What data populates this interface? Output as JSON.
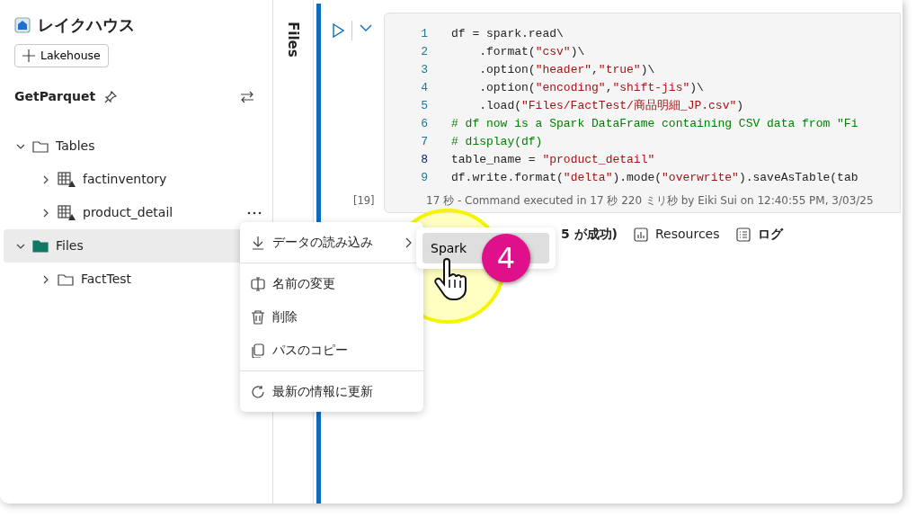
{
  "app": {
    "title": "レイクハウス",
    "add_button": "Lakehouse"
  },
  "lakehouse": {
    "name": "GetParquet"
  },
  "tree": [
    {
      "label": "Tables",
      "kind": "folder",
      "expanded": true,
      "selected": false,
      "children": [
        {
          "label": "factinventory",
          "kind": "table",
          "expanded": false,
          "selected": false
        },
        {
          "label": "product_detail",
          "kind": "table",
          "expanded": false,
          "selected": false,
          "more": true
        }
      ]
    },
    {
      "label": "Files",
      "kind": "files",
      "expanded": true,
      "selected": true,
      "children": [
        {
          "label": "FactTest",
          "kind": "folder",
          "expanded": false,
          "selected": false
        }
      ]
    }
  ],
  "side_tab": "Files",
  "cell": {
    "lines": [
      {
        "number": "1",
        "current": false,
        "tokens": [
          {
            "kind": "plain",
            "text": "df = spark.read\\"
          }
        ]
      },
      {
        "number": "2",
        "current": false,
        "tokens": [
          {
            "kind": "plain",
            "text": "    .format("
          },
          {
            "kind": "string",
            "text": "\"csv\""
          },
          {
            "kind": "plain",
            "text": ")\\"
          }
        ]
      },
      {
        "number": "3",
        "current": false,
        "tokens": [
          {
            "kind": "plain",
            "text": "    .option("
          },
          {
            "kind": "string",
            "text": "\"header\""
          },
          {
            "kind": "plain",
            "text": ","
          },
          {
            "kind": "string",
            "text": "\"true\""
          },
          {
            "kind": "plain",
            "text": ")\\"
          }
        ]
      },
      {
        "number": "4",
        "current": false,
        "tokens": [
          {
            "kind": "plain",
            "text": "    .option("
          },
          {
            "kind": "string",
            "text": "\"encoding\""
          },
          {
            "kind": "plain",
            "text": ","
          },
          {
            "kind": "string",
            "text": "\"shift-jis\""
          },
          {
            "kind": "plain",
            "text": ")\\"
          }
        ]
      },
      {
        "number": "5",
        "current": false,
        "tokens": [
          {
            "kind": "plain",
            "text": "    .load("
          },
          {
            "kind": "string",
            "text": "\"Files/FactTest/商品明細_JP.csv\""
          },
          {
            "kind": "plain",
            "text": ")"
          }
        ]
      },
      {
        "number": "6",
        "current": false,
        "tokens": [
          {
            "kind": "comment",
            "text": "# df now is a Spark DataFrame containing CSV data from \"Fi"
          }
        ]
      },
      {
        "number": "7",
        "current": false,
        "tokens": [
          {
            "kind": "comment",
            "text": "# display(df)"
          }
        ]
      },
      {
        "number": "8",
        "current": true,
        "tokens": [
          {
            "kind": "plain",
            "text": "table_name = "
          },
          {
            "kind": "string",
            "text": "\"product_detail\""
          }
        ]
      },
      {
        "number": "9",
        "current": false,
        "tokens": [
          {
            "kind": "plain",
            "text": "df.write.format("
          },
          {
            "kind": "string",
            "text": "\"delta\""
          },
          {
            "kind": "plain",
            "text": ").mode("
          },
          {
            "kind": "string",
            "text": "\"overwrite\""
          },
          {
            "kind": "plain",
            "text": ").saveAsTable(tab"
          }
        ]
      }
    ],
    "exec_count": "[19]",
    "status": "17 秒 - Command executed in 17 秒 220 ミリ秒 by Eiki Sui on 12:40:55 PM, 3/03/25"
  },
  "output_bar": [
    {
      "label": "5 が成功)",
      "kind": "jobs"
    },
    {
      "label": "Resources",
      "kind": "resources"
    },
    {
      "label": "ログ",
      "kind": "log"
    }
  ],
  "context_menu": {
    "groups": [
      [
        {
          "label": "データの読み込み",
          "kind": "load",
          "submenu": true
        }
      ],
      [
        {
          "label": "名前の変更",
          "kind": "rename",
          "submenu": false
        },
        {
          "label": "削除",
          "kind": "delete",
          "submenu": false
        },
        {
          "label": "パスのコピー",
          "kind": "copy",
          "submenu": false
        }
      ],
      [
        {
          "label": "最新の情報に更新",
          "kind": "refresh",
          "submenu": false
        }
      ]
    ]
  },
  "submenu": {
    "items": [
      {
        "label": "Spark",
        "selected": true
      }
    ]
  },
  "step_badge": "4"
}
